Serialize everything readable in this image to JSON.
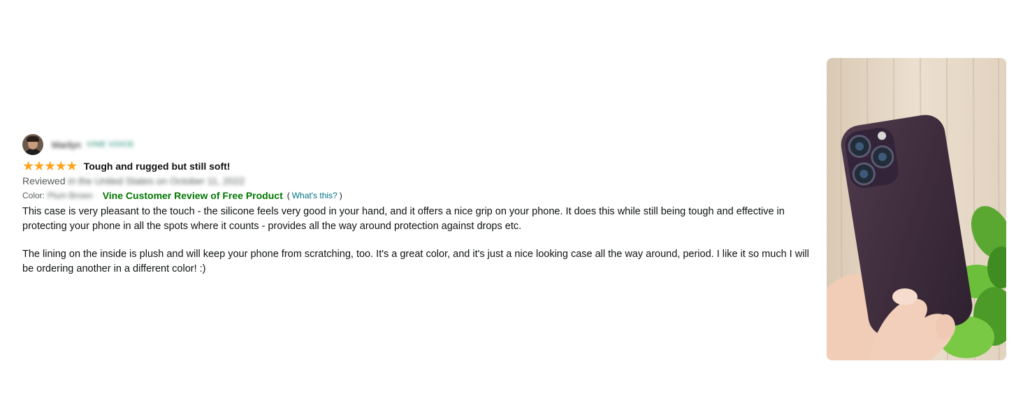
{
  "review": {
    "profile": {
      "name": "Marilyn",
      "badge": "VINE VOICE",
      "avatar_icon": "user-avatar"
    },
    "rating": {
      "stars": 5,
      "out_of": 5,
      "star_glyph": "★",
      "star_color": "#ffa41c"
    },
    "title": "Tough and rugged but still soft!",
    "reviewed_label": "Reviewed",
    "reviewed_detail": "in the United States on October 11, 2022",
    "color_label": "Color:",
    "color_value": "Plum Brown",
    "vine_label": "Vine Customer Review of Free Product",
    "whats_this": {
      "open": "(",
      "link": "What's this?",
      "close": ")"
    },
    "body": [
      "This case is very pleasant to the touch - the silicone feels very good in your hand, and it offers a nice grip on your phone. It does this while still being tough and effective in protecting your phone in all the spots where it counts - provides all the way around protection against drops etc.",
      "The lining on the inside is plush and will keep your phone from scratching, too. It's a great color, and it's just a nice looking case all the way around, period. I like it so much I will be ordering another in a different color! :)"
    ],
    "image": {
      "subject": "hand holding phone in plum silicone case",
      "case_color": "#3d2b3a"
    }
  },
  "colors": {
    "vine_green": "#007600",
    "link_teal": "#007185",
    "muted_text": "#565959",
    "text": "#0f1111"
  }
}
